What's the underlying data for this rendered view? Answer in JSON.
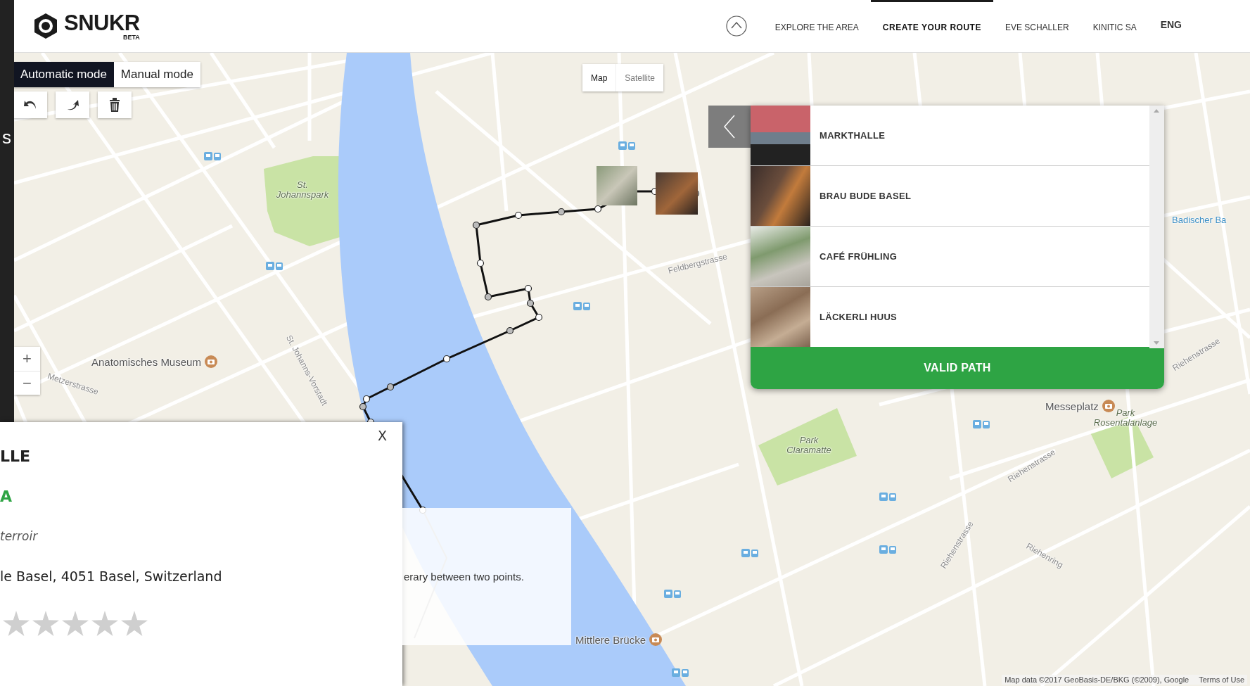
{
  "edge_text": "s",
  "logo": {
    "name": "SNUKR",
    "badge": "BETA"
  },
  "nav": [
    {
      "label": "EXPLORE THE AREA",
      "selected": false
    },
    {
      "label": "CREATE YOUR ROUTE",
      "selected": true
    },
    {
      "label": "EVE SCHALLER",
      "selected": false
    },
    {
      "label": "KINITIC SA",
      "selected": false
    },
    {
      "label": "ENG",
      "selected": false
    }
  ],
  "modes": [
    {
      "label": "Automatic mode",
      "selected": true
    },
    {
      "label": "Manual mode",
      "selected": false
    }
  ],
  "map_types": [
    {
      "label": "Map",
      "selected": true
    },
    {
      "label": "Satellite",
      "selected": false
    }
  ],
  "zoom": {
    "in": "+",
    "out": "−"
  },
  "map_labels": [
    {
      "text": "St. Johannspark",
      "kind": "park"
    },
    {
      "text": "Anatomisches Museum",
      "kind": "poi"
    },
    {
      "text": "Metzerstrasse",
      "kind": "street"
    },
    {
      "text": "St. Johanns-Vorstadt",
      "kind": "street"
    },
    {
      "text": "Feldbergstrasse",
      "kind": "street"
    },
    {
      "text": "Park Claramatte",
      "kind": "park"
    },
    {
      "text": "Messeplatz",
      "kind": "poi"
    },
    {
      "text": "Park Rosentalanlage",
      "kind": "park"
    },
    {
      "text": "Riehenstrasse",
      "kind": "street"
    },
    {
      "text": "Riehenstrasse",
      "kind": "street"
    },
    {
      "text": "Riehenstrasse",
      "kind": "street"
    },
    {
      "text": "Riehenring",
      "kind": "street"
    },
    {
      "text": "Mittlere Brücke",
      "kind": "poi"
    },
    {
      "text": "Badischer Ba",
      "kind": "transit"
    }
  ],
  "places": [
    {
      "name": "MARKTHALLE"
    },
    {
      "name": "BRAU BUDE BASEL"
    },
    {
      "name": "CAFÉ FRÜHLING"
    },
    {
      "name": "LÄCKERLI HUUS"
    }
  ],
  "valid_button": "VALID PATH",
  "popup": {
    "title": "LLE",
    "category": "A",
    "subtitle": "terroir",
    "address": "le Basel, 4051 Basel, Switzerland",
    "stars": 0,
    "close": "X"
  },
  "tooltip": "erary between two points.",
  "attribution": [
    "Map data ©2017 GeoBasis-DE/BKG (©2009), Google",
    "Terms of Use"
  ]
}
